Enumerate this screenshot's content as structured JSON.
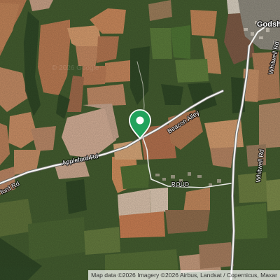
{
  "map": {
    "type": "satellite",
    "places": {
      "town": "Godsh",
      "hamlet": "ROUD"
    },
    "roads": {
      "appleford_main": "Appleford Rd",
      "appleford_west": "ford Rd",
      "beacon": "Beacon Alley",
      "whitwell_north": "Whitwell Rd",
      "whitwell_south": "Whitwell Rd"
    },
    "marker": {
      "icon": "location-pin-icon",
      "color": "#21a25b"
    },
    "watermark": "© 2026 Google",
    "attribution": "Map data ©2026 Imagery ©2026 Airbus, Landsat / Copernicus, Maxar"
  }
}
